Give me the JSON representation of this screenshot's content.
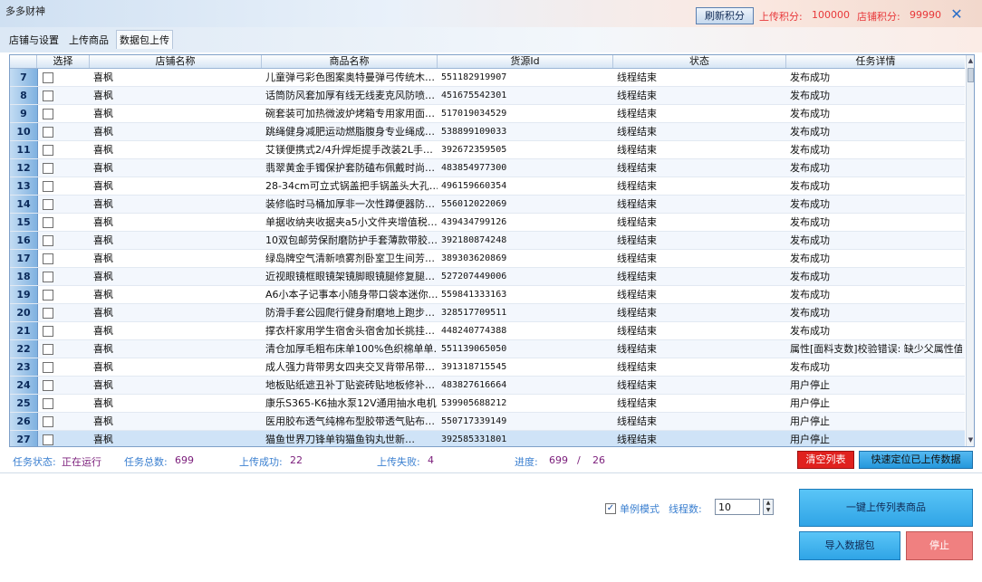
{
  "app": {
    "title": "多多财神",
    "refresh_button": "刷新积分",
    "upload_points_label": "上传积分:",
    "upload_points_value": "100000",
    "shop_points_label": "店铺积分:",
    "shop_points_value": "99990",
    "close_icon": "close-icon"
  },
  "tabs": [
    {
      "label": "店铺与设置"
    },
    {
      "label": "上传商品"
    },
    {
      "label": "数据包上传"
    }
  ],
  "grid": {
    "columns": [
      "选择",
      "店铺名称",
      "商品名称",
      "货源Id",
      "状态",
      "任务详情"
    ],
    "rows": [
      {
        "num": "7",
        "shop": "喜枫",
        "name": "儿童弹弓彩色图案奥特曼弹弓传统木…",
        "id": "551182919907",
        "status": "线程结束",
        "detail": "发布成功"
      },
      {
        "num": "8",
        "shop": "喜枫",
        "name": "话筒防风套加厚有线无线麦克风防喷…",
        "id": "451675542301",
        "status": "线程结束",
        "detail": "发布成功"
      },
      {
        "num": "9",
        "shop": "喜枫",
        "name": "碗套装可加热微波炉烤箱专用家用面…",
        "id": "517019034529",
        "status": "线程结束",
        "detail": "发布成功"
      },
      {
        "num": "10",
        "shop": "喜枫",
        "name": "跳绳健身减肥运动燃脂腹身专业绳成…",
        "id": "538899109033",
        "status": "线程结束",
        "detail": "发布成功"
      },
      {
        "num": "11",
        "shop": "喜枫",
        "name": "艾镁便携式2/4升焊炬提手改装2L手…",
        "id": "392672359505",
        "status": "线程结束",
        "detail": "发布成功"
      },
      {
        "num": "12",
        "shop": "喜枫",
        "name": "翡翠黄金手镯保护套防磕布佩戴时尚…",
        "id": "483854977300",
        "status": "线程结束",
        "detail": "发布成功"
      },
      {
        "num": "13",
        "shop": "喜枫",
        "name": "28-34cm可立式锅盖把手锅盖头大孔…",
        "id": "496159660354",
        "status": "线程结束",
        "detail": "发布成功"
      },
      {
        "num": "14",
        "shop": "喜枫",
        "name": "装修临时马桶加厚非一次性蹲便器防…",
        "id": "556012022069",
        "status": "线程结束",
        "detail": "发布成功"
      },
      {
        "num": "15",
        "shop": "喜枫",
        "name": "单据收纳夹收据夹a5小文件夹增值税…",
        "id": "439434799126",
        "status": "线程结束",
        "detail": "发布成功"
      },
      {
        "num": "16",
        "shop": "喜枫",
        "name": "10双包邮劳保耐磨防护手套薄款带胶…",
        "id": "392180874248",
        "status": "线程结束",
        "detail": "发布成功"
      },
      {
        "num": "17",
        "shop": "喜枫",
        "name": "绿岛牌空气清新喷雾剂卧室卫生间芳…",
        "id": "389303620869",
        "status": "线程结束",
        "detail": "发布成功"
      },
      {
        "num": "18",
        "shop": "喜枫",
        "name": "近视眼镜框眼镜架镜脚眼镜腿修复腿…",
        "id": "527207449006",
        "status": "线程结束",
        "detail": "发布成功"
      },
      {
        "num": "19",
        "shop": "喜枫",
        "name": "A6小本子记事本小随身带口袋本迷你…",
        "id": "559841333163",
        "status": "线程结束",
        "detail": "发布成功"
      },
      {
        "num": "20",
        "shop": "喜枫",
        "name": "防滑手套公园爬行健身耐磨地上跑步…",
        "id": "328517709511",
        "status": "线程结束",
        "detail": "发布成功"
      },
      {
        "num": "21",
        "shop": "喜枫",
        "name": "撑衣杆家用学生宿舍头宿舍加长挑挂…",
        "id": "448240774388",
        "status": "线程结束",
        "detail": "发布成功"
      },
      {
        "num": "22",
        "shop": "喜枫",
        "name": "清仓加厚毛粗布床单100%色织棉单单…",
        "id": "551139065050",
        "status": "线程结束",
        "detail": "属性[面料支数]校验错误: 缺少父属性值"
      },
      {
        "num": "23",
        "shop": "喜枫",
        "name": "成人强力背带男女四夹交叉背带吊带…",
        "id": "391318715545",
        "status": "线程结束",
        "detail": "发布成功"
      },
      {
        "num": "24",
        "shop": "喜枫",
        "name": "地板贴纸遮丑补丁贴瓷砖贴地板修补…",
        "id": "483827616664",
        "status": "线程结束",
        "detail": "用户停止"
      },
      {
        "num": "25",
        "shop": "喜枫",
        "name": "康乐S365-K6抽水泵12V通用抽水电机…",
        "id": "539905688212",
        "status": "线程结束",
        "detail": "用户停止"
      },
      {
        "num": "26",
        "shop": "喜枫",
        "name": "医用胶布透气纯棉布型胶带透气贴布…",
        "id": "550717339149",
        "status": "线程结束",
        "detail": "用户停止"
      },
      {
        "num": "27",
        "shop": "喜枫",
        "name": "猫鱼世界刀锋单钩猫鱼钩丸世新…",
        "id": "392585331801",
        "status": "线程结束",
        "detail": "用户停止"
      }
    ]
  },
  "status": {
    "task_state_label": "任务状态:",
    "task_state_value": "正在运行",
    "task_total_label": "任务总数:",
    "task_total_value": "699",
    "upload_ok_label": "上传成功:",
    "upload_ok_value": "22",
    "upload_fail_label": "上传失败:",
    "upload_fail_value": "4",
    "progress_label": "进度:",
    "progress_value": "699",
    "progress_sep": "/",
    "progress_done": "26"
  },
  "buttons": {
    "clear_list": "清空列表",
    "locate_uploaded": "快速定位已上传数据",
    "upload_all": "一键上传列表商品",
    "import_package": "导入数据包",
    "stop": "停止"
  },
  "options": {
    "single_mode_label": "单例模式",
    "single_mode_checked": "✓",
    "thread_count_label": "线程数:",
    "thread_count_value": "10"
  }
}
